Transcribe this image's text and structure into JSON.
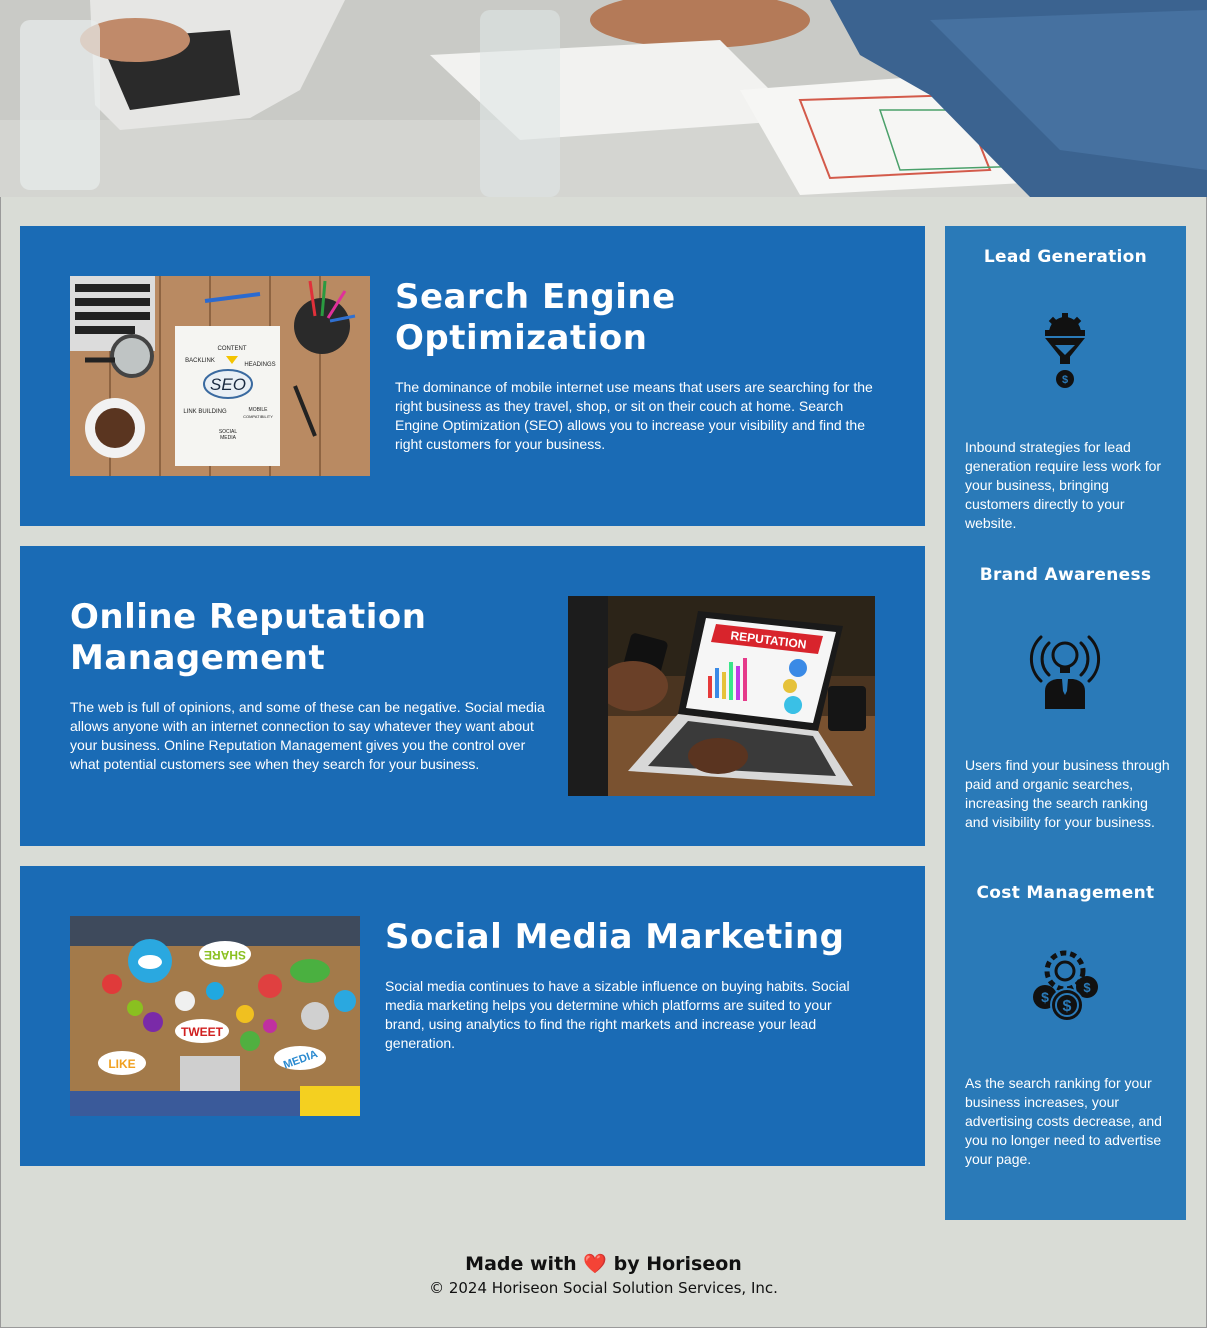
{
  "services": [
    {
      "title": "Search Engine Optimization",
      "description": "The dominance of mobile internet use means that users are searching for the right business as they travel, shop, or sit on their couch at home. Search Engine Optimization (SEO) allows you to increase your visibility and find the right customers for your business.",
      "image_text": {
        "seo": "SEO",
        "content": "CONTENT",
        "backlink": "BACKLINK",
        "headings": "HEADINGS",
        "link_building": "LINK BUILDING",
        "mobile": "MOBILE",
        "compat": "COMPATIBILITY",
        "social": "SOCIAL",
        "media": "MEDIA"
      }
    },
    {
      "title": "Online Reputation Management",
      "description": "The web is full of opinions, and some of these can be negative. Social media allows anyone with an internet connection to say whatever they want about your business. Online Reputation Management gives you the control over what potential customers see when they search for your business.",
      "image_text": {
        "banner": "REPUTATION"
      }
    },
    {
      "title": "Social Media Marketing",
      "description": "Social media continues to have a sizable influence on buying habits. Social media marketing helps you determine which platforms are suited to your brand, using analytics to find the right markets and increase your lead generation.",
      "image_text": {
        "share": "SHARE",
        "tweet": "TWEET",
        "like": "LIKE",
        "media": "MEDIA"
      }
    }
  ],
  "benefits": [
    {
      "title": "Lead Generation",
      "icon": "lead-generation-icon",
      "description": "Inbound strategies for lead generation require less work for your business, bringing customers directly to your website."
    },
    {
      "title": "Brand Awareness",
      "icon": "brand-awareness-icon",
      "description": "Users find your business through paid and organic searches, increasing the search ranking and visibility for your business."
    },
    {
      "title": "Cost Management",
      "icon": "cost-management-icon",
      "description": "As the search ranking for your business increases, your advertising costs decrease, and you no longer need to advertise your page."
    }
  ],
  "footer": {
    "made_prefix": "Made with",
    "heart": "❤️",
    "made_suffix": "by Horiseon",
    "copyright": "© 2024 Horiseon Social Solution Services, Inc."
  },
  "colors": {
    "card_bg": "#1a6bb5",
    "sidebar_bg": "#2a7ab8",
    "page_bg": "#d9dcd6"
  }
}
